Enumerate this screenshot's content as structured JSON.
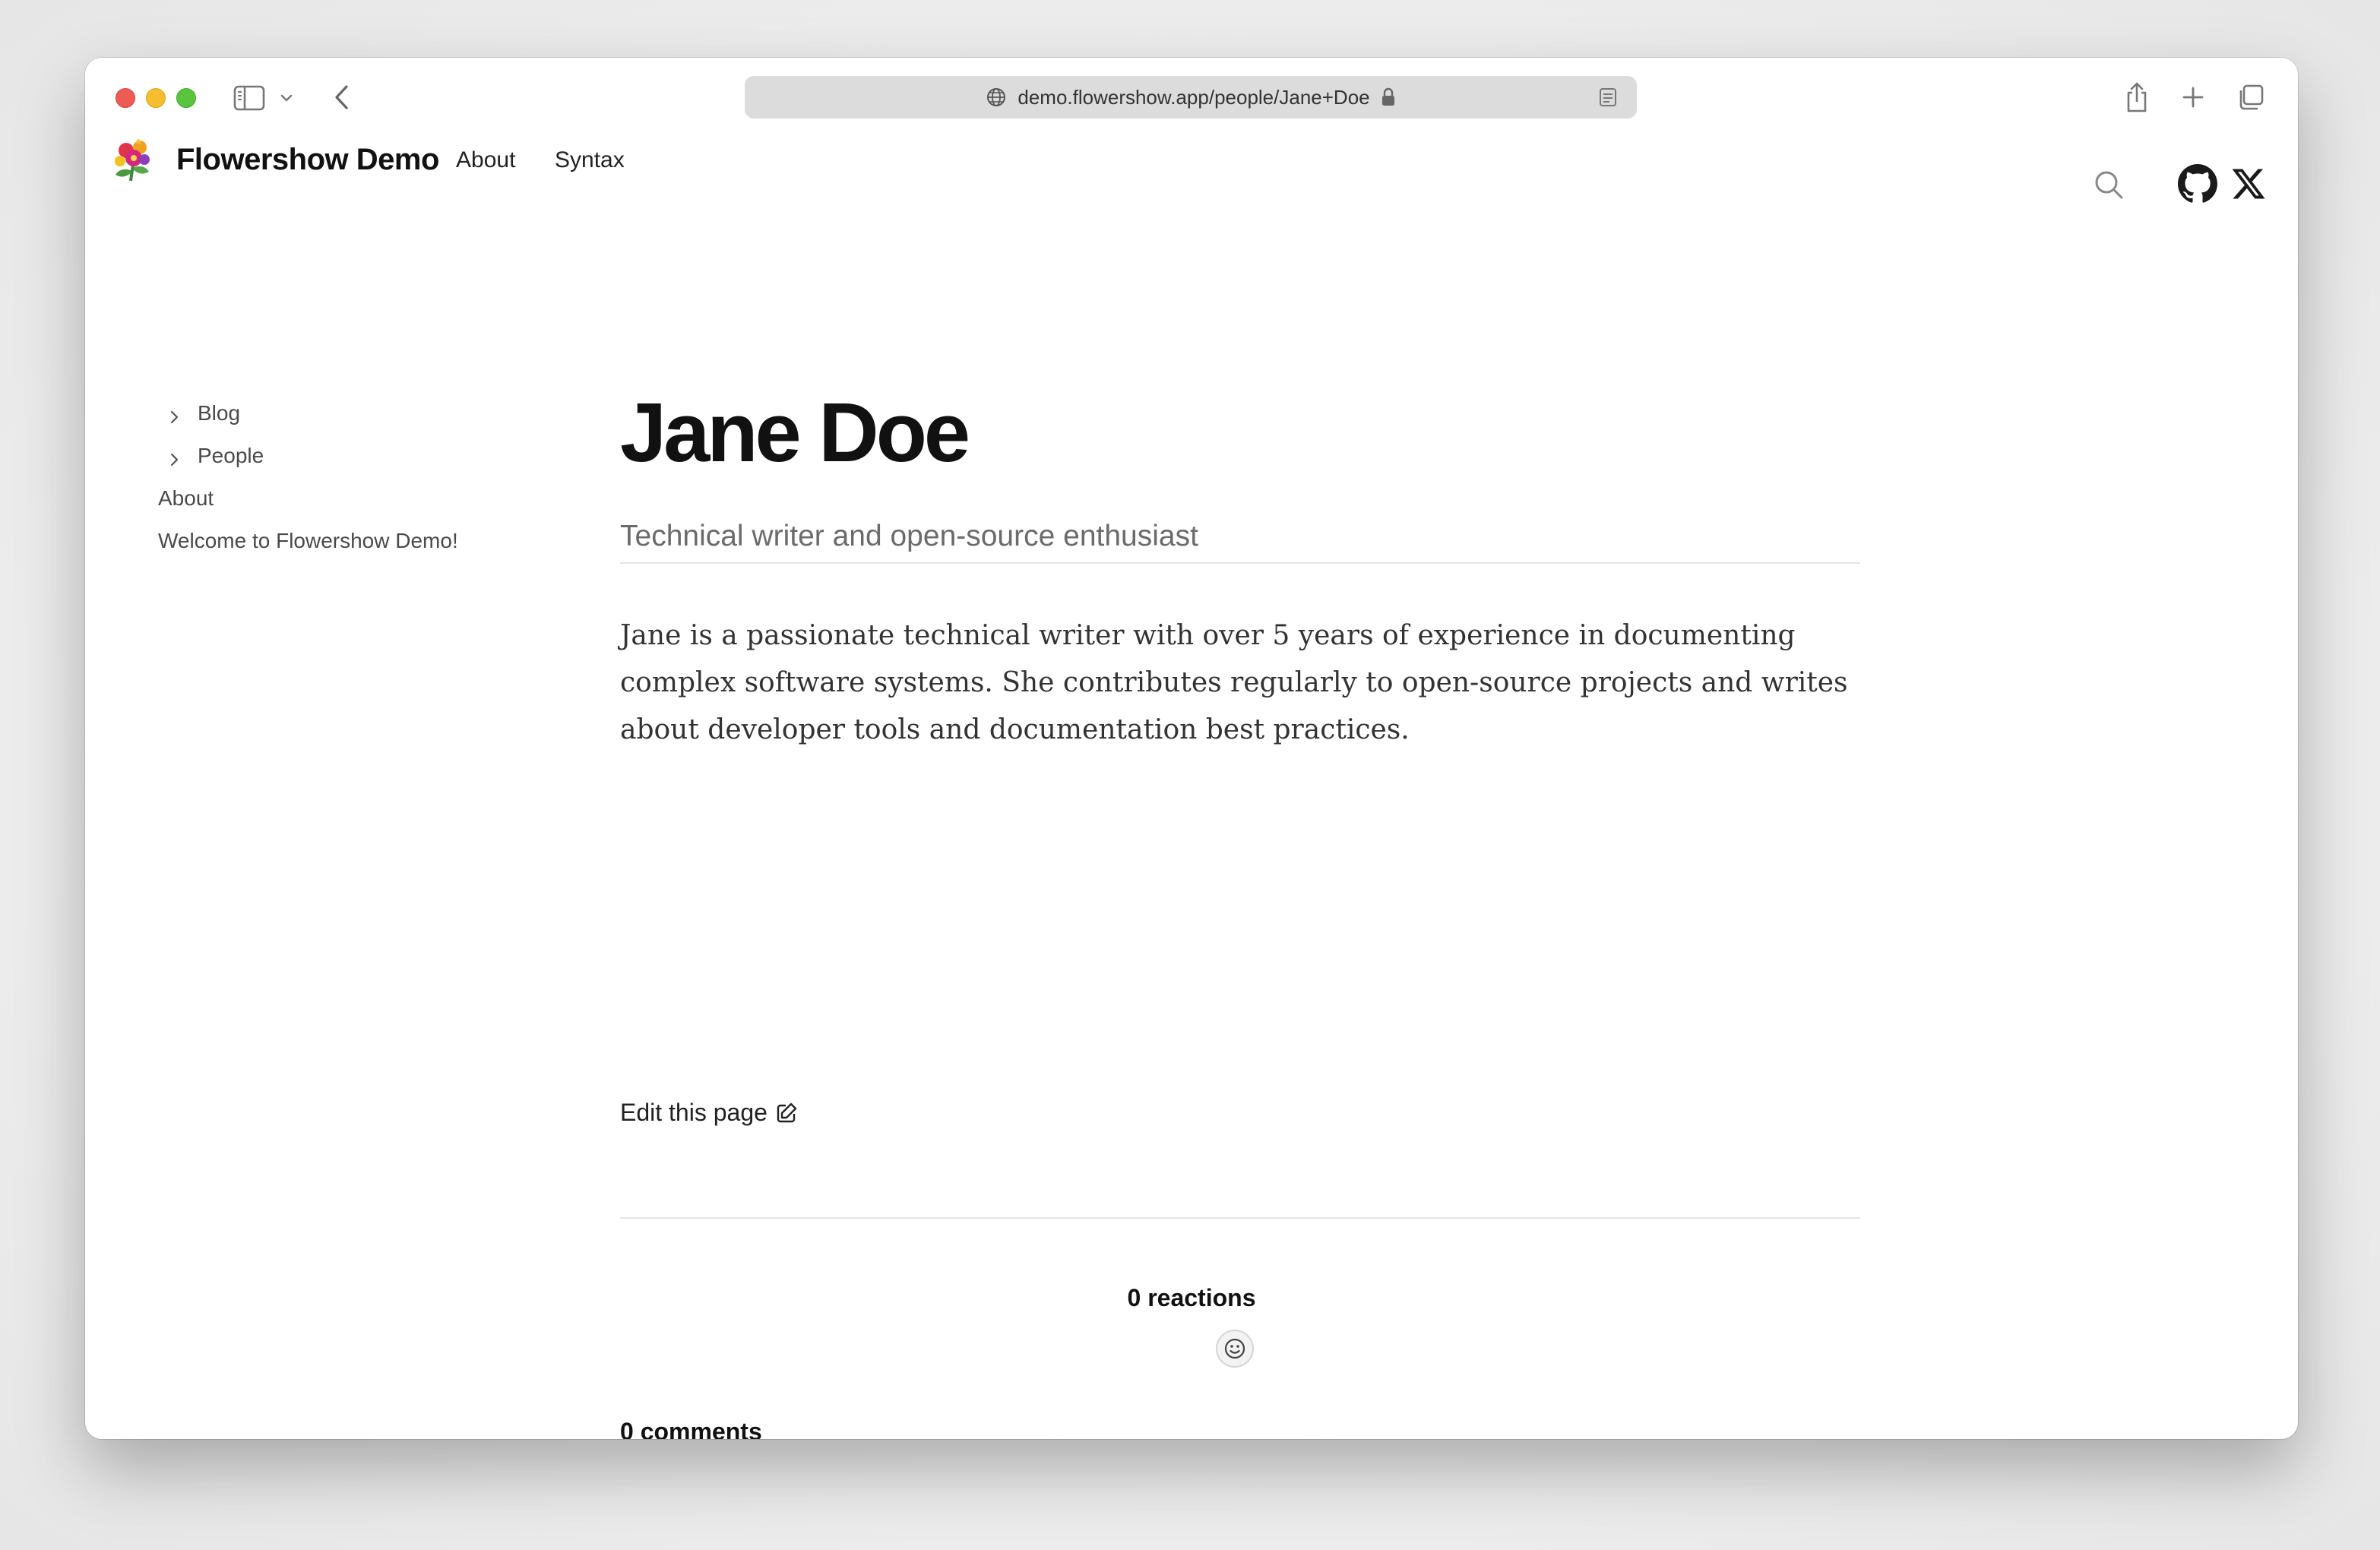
{
  "browser": {
    "url": "demo.flowershow.app/people/Jane+Doe",
    "icons": {
      "sidebar": "sidebar-icon",
      "chevron": "chevron-down-icon",
      "back": "back-arrow-icon",
      "globe": "globe-icon",
      "lock": "lock-icon",
      "reader": "reader-mode-icon",
      "share": "share-icon",
      "new_tab": "plus-icon",
      "tabs": "tabs-overview-icon"
    },
    "colors": {
      "close": "#ee5b55",
      "minimize": "#f5bd30",
      "zoom": "#5ac43f"
    }
  },
  "header": {
    "site_title": "Flowershow Demo",
    "nav": [
      "About",
      "Syntax"
    ],
    "icons": [
      "search-icon",
      "github-icon",
      "x-logo-icon"
    ]
  },
  "sidebar": {
    "items": [
      {
        "label": "Blog",
        "expandable": true
      },
      {
        "label": "People",
        "expandable": true
      },
      {
        "label": "About",
        "expandable": false
      },
      {
        "label": "Welcome to Flowershow Demo!",
        "expandable": false
      }
    ]
  },
  "page": {
    "title": "Jane Doe",
    "subtitle": "Technical writer and open-source enthusiast",
    "body": "Jane is a passionate technical writer with over 5 years of experience in documenting complex software systems. She contributes regularly to open-source projects and writes about developer tools and documentation best practices.",
    "edit_label": "Edit this page"
  },
  "feedback": {
    "reactions_label": "0 reactions",
    "comments_label": "0 comments"
  }
}
